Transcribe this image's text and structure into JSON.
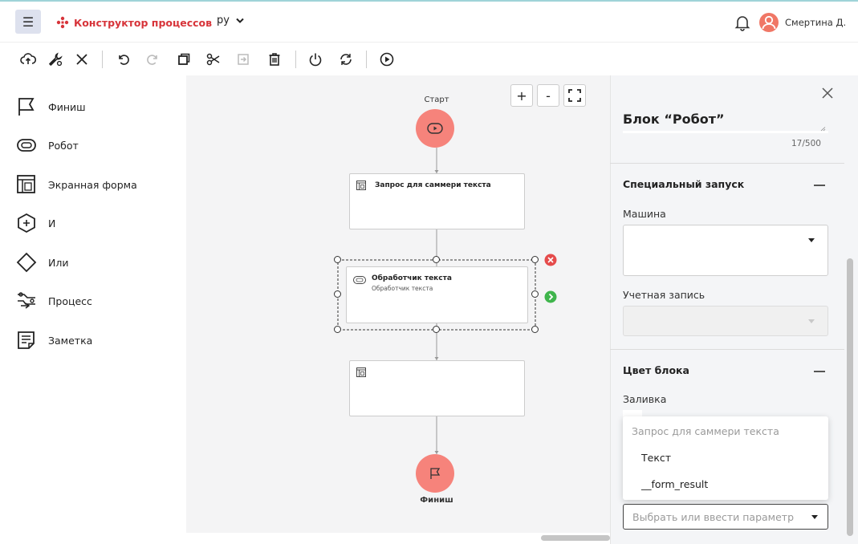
{
  "header": {
    "menu_icon": "hamburger-icon",
    "app_title": "Конструктор процессов",
    "language": "ру",
    "user_name": "Смертина Д.",
    "brand_color": "#d7343a"
  },
  "toolbar": {
    "icons": [
      "cloud-upload-icon",
      "wrench-settings-icon",
      "close-icon",
      "undo-icon",
      "redo-icon",
      "copy-icon",
      "cut-icon",
      "paste-icon",
      "delete-icon",
      "power-icon",
      "refresh-icon",
      "play-icon"
    ]
  },
  "palette": {
    "items": [
      {
        "label": "Финиш",
        "icon": "flag-icon"
      },
      {
        "label": "Робот",
        "icon": "robot-icon"
      },
      {
        "label": "Экранная форма",
        "icon": "screen-form-icon"
      },
      {
        "label": "И",
        "icon": "and-gateway-icon"
      },
      {
        "label": "Или",
        "icon": "or-gateway-icon"
      },
      {
        "label": "Процесс",
        "icon": "process-icon"
      },
      {
        "label": "Заметка",
        "icon": "note-icon"
      }
    ]
  },
  "canvas": {
    "zoom_in": "+",
    "zoom_out": "-",
    "start_label": "Старт",
    "finish_label": "Финиш",
    "block1_title": "Запрос для саммери текста",
    "block2_title": "Обработчик текста",
    "block2_subtitle": "Обработчик текста",
    "node_color": "#f6837b"
  },
  "panel": {
    "title": "Блок “Робот”",
    "counter": "17/500",
    "special_launch": "Специальный запуск",
    "machine_label": "Машина",
    "account_label": "Учетная запись",
    "block_color": "Цвет блока",
    "fill_label": "Заливка",
    "dropdown_options": [
      "Запрос для саммери текста",
      "Текст",
      "__form_result"
    ],
    "param_placeholder": "Выбрать или ввести параметр"
  }
}
